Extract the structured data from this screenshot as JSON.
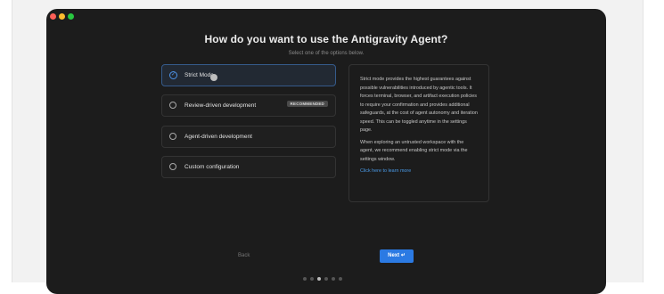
{
  "dialog": {
    "title": "How do you want to use the Antigravity Agent?",
    "subtitle": "Select one of the options below."
  },
  "options": [
    {
      "label": "Strict Mode",
      "selected": true
    },
    {
      "label": "Review-driven development",
      "selected": false,
      "badge": "RECOMMENDED"
    },
    {
      "label": "Agent-driven development",
      "selected": false
    },
    {
      "label": "Custom configuration",
      "selected": false
    }
  ],
  "info": {
    "paragraph1": "Strict mode provides the highest guarantees against possible vulnerabilities introduced by agentic tools. It forces terminal, browser, and artifact execution policies to require your confirmation and provides additional safeguards, at the cost of agent autonomy and iteration speed. This can be toggled anytime in the settings page.",
    "paragraph2": "When exploring an untrusted workspace with the agent, we recommend enabling strict mode via the settings window.",
    "link": "Click here to learn more"
  },
  "footer": {
    "back_label": "Back",
    "next_label": "Next ↵"
  },
  "progress": {
    "steps": 6,
    "current": 3
  },
  "colors": {
    "accent": "#2b7ae3",
    "link": "#4a9be8",
    "window_bg": "#1c1c1c",
    "traffic_red": "#ff5f57",
    "traffic_yellow": "#febc2e",
    "traffic_green": "#28c840"
  }
}
